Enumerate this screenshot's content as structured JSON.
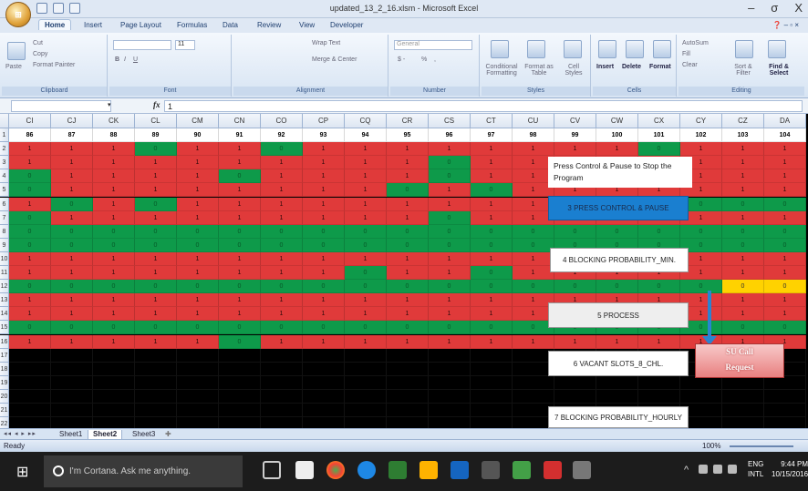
{
  "window": {
    "title": "updated_13_2_16.xlsm - Microsoft Excel",
    "minimize": "–",
    "maximize": "σ",
    "close": "X",
    "office_button_label": "⊞"
  },
  "ribbon_tabs": [
    "Home",
    "Insert",
    "Page Layout",
    "Formulas",
    "Data",
    "Review",
    "View",
    "Developer"
  ],
  "ribbon_groups": {
    "clipboard": {
      "label": "Clipboard",
      "paste": "Paste",
      "cut": "Cut",
      "copy": "Copy",
      "format_painter": "Format Painter"
    },
    "font": {
      "label": "Font",
      "font_size": "11",
      "bold": "B",
      "italic": "I",
      "underline": "U"
    },
    "alignment": {
      "label": "Alignment",
      "wrap_text": "Wrap Text",
      "merge_center": "Merge & Center"
    },
    "number": {
      "label": "Number",
      "format": "General",
      "currency": "$ -",
      "percent": "%",
      "comma": ","
    },
    "styles": {
      "label": "Styles",
      "conditional": "Conditional Formatting",
      "format_table": "Format as Table",
      "cell_styles": "Cell Styles"
    },
    "cells": {
      "label": "Cells",
      "insert": "Insert",
      "delete": "Delete",
      "format": "Format"
    },
    "editing": {
      "label": "Editing",
      "autosum": "AutoSum",
      "fill": "Fill",
      "clear": "Clear",
      "sort_filter": "Sort & Filter",
      "find_select": "Find & Select"
    }
  },
  "formula_bar": {
    "name_box": "",
    "fx": "fx",
    "formula": "1"
  },
  "grid": {
    "columns": [
      "CI",
      "CJ",
      "CK",
      "CL",
      "CM",
      "CN",
      "CO",
      "CP",
      "CQ",
      "CR",
      "CS",
      "CT",
      "CU",
      "CV",
      "CW",
      "CX",
      "CY",
      "CZ",
      "DA"
    ],
    "row_numbers": [
      1,
      2,
      3,
      4,
      5,
      6,
      7,
      8,
      9,
      10,
      11,
      12,
      13,
      14,
      15,
      16,
      17,
      18,
      19,
      20,
      21,
      22
    ],
    "row1_values": [
      "86",
      "87",
      "88",
      "89",
      "90",
      "91",
      "92",
      "93",
      "94",
      "95",
      "96",
      "97",
      "98",
      "99",
      "100",
      "101",
      "102",
      "103",
      "104"
    ],
    "color_rows": [
      "RRRGRRGRRRRRRRRGRRR",
      "RRRRRRRRRRGRRRRRRRR",
      "GRRRRGRRRRGRRRRRRRR",
      "GRRRRRRRRGRGRRRRRRR",
      "RGRGRRRRRRRRRRRRGGG",
      "GRRRRRRRRRGRRRRRRRR",
      "GGGGGGGGGGGGGGGGGGG",
      "GGGGGGGGGGGGGGGGGGG",
      "RRRRRRRRRRRRRRRRRRR",
      "RRRRRRRRGRRGRRRRRRR",
      "GGGGGGGGGGGGGGGGGYY",
      "RRRRRRRRRRRRRRRRRRR",
      "RRRRRRRRRRRRRRRRRRR",
      "GGGGGGGGGGGGGGGGGGG",
      "RRRRRGRRRRRRRRRRRRR"
    ],
    "cell_value_red": "1",
    "cell_value_green": "0",
    "cell_value_yellow": "0"
  },
  "buttons": {
    "press_pause_note": "Press Control & Pause to Stop the Program",
    "press_control_pause": "3 PRESS CONTROL & PAUSE",
    "blocking_min": "4 BLOCKING PROBABILITY_MIN.",
    "process": "5 PROCESS",
    "vacant_slots": "6 VACANT SLOTS_8_CHL.",
    "blocking_hourly": "7 BLOCKING PROBABILITY_HOURLY",
    "su_call_request_line1": "SU Call",
    "su_call_request_line2": "Request"
  },
  "sheet_tabs": {
    "nav": "◂◂ ◂ ▸ ▸▸",
    "tabs": [
      "Sheet1",
      "Sheet2",
      "Sheet3"
    ],
    "active": "Sheet2"
  },
  "status_bar": {
    "ready": "Ready",
    "zoom": "100%"
  },
  "taskbar": {
    "search_placeholder": "I'm Cortana. Ask me anything.",
    "lang1": "ENG",
    "lang2": "INTL",
    "time": "9:44 PM",
    "date": "10/15/2016"
  },
  "colors": {
    "red": "#e03a3a",
    "green": "#0e9a4a",
    "yellow": "#ffd200",
    "blue_button": "#1a7fd0",
    "arrow": "#2a84d0"
  }
}
